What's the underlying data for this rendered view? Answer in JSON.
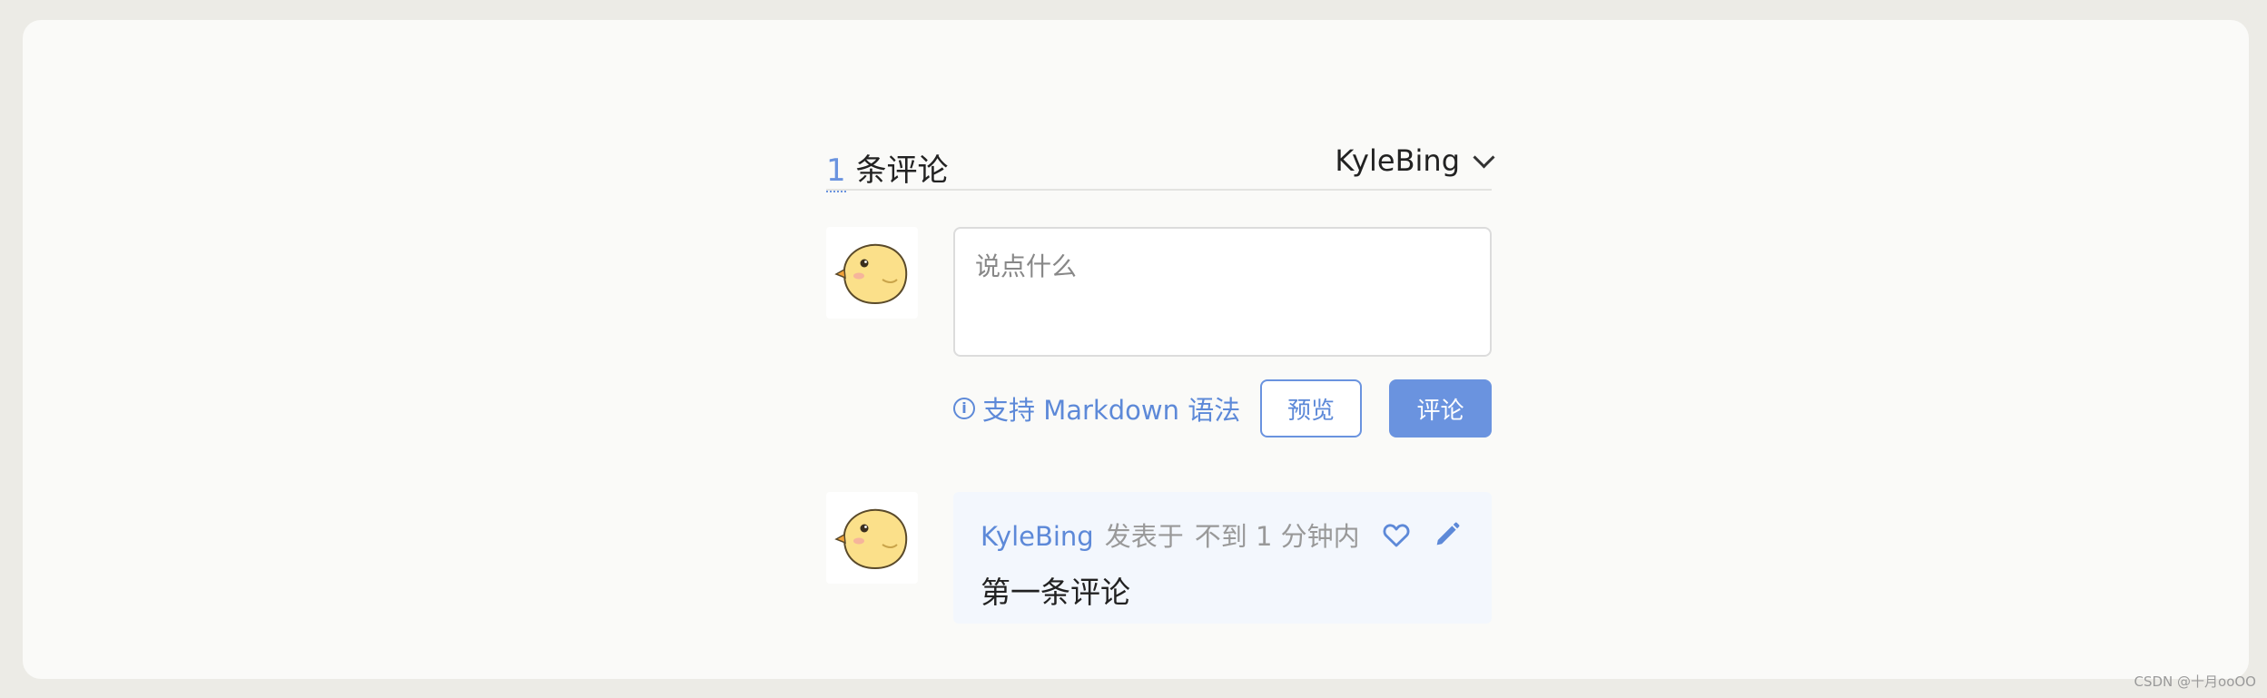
{
  "header": {
    "count": "1",
    "count_suffix": "条评论",
    "user_name": "KyleBing"
  },
  "composer": {
    "placeholder": "说点什么",
    "markdown_tip": "支持 Markdown 语法",
    "preview_label": "预览",
    "submit_label": "评论"
  },
  "comments": [
    {
      "author": "KyleBing",
      "posted_label": "发表于",
      "time": "不到 1 分钟内",
      "content": "第一条评论"
    }
  ],
  "icons": {
    "info": "info-icon",
    "heart": "heart-icon",
    "edit": "pencil-icon",
    "chevron": "chevron-down-icon",
    "avatar": "chick-avatar"
  },
  "colors": {
    "accent": "#6a93df",
    "comment_bg": "#f3f7fd",
    "page_bg": "#ecebe6"
  },
  "watermark": "CSDN @十月ooOO"
}
